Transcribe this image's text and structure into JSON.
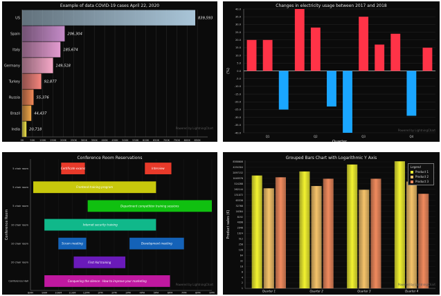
{
  "colors": {
    "panel_bg": "#0b0b0b",
    "text": "#e6e6e6",
    "grid": "#2e2e2e",
    "positive_bar": "#ff3347",
    "negative_bar": "#1aa6ff",
    "product_1": "#f2f230",
    "product_2": "#f5c36a",
    "product_3": "#f08a5d"
  },
  "watermark": "Powered by LightningChart",
  "chart_data": [
    {
      "type": "bar",
      "orientation": "horizontal",
      "title": "Example of data COVID-19 cases April 22, 2020",
      "categories": [
        "US",
        "Spain",
        "Italy",
        "Germany",
        "Turkey",
        "Russia",
        "Brazil",
        "India"
      ],
      "values": [
        839593,
        206304,
        185674,
        149518,
        92877,
        55376,
        44437,
        20718
      ],
      "value_labels": [
        "839,593",
        "206,304",
        "185,674",
        "149,518",
        "92,877",
        "55,376",
        "44,437",
        "20,718"
      ],
      "bar_colors": [
        "#a9c5d8",
        "#c58bc8",
        "#e39bd0",
        "#f5a8c8",
        "#f6857e",
        "#f08858",
        "#f4a94a",
        "#f2e44a"
      ],
      "xlim": [
        0,
        900000
      ],
      "x_ticks": [
        "0K",
        "50K",
        "100K",
        "150K",
        "200K",
        "250K",
        "300K",
        "350K",
        "400K",
        "450K",
        "500K",
        "550K",
        "600K",
        "650K",
        "700K",
        "750K",
        "800K",
        "850K"
      ]
    },
    {
      "type": "bar",
      "title": "Changes in electricity usage between 2017 and 2018",
      "xlabel": "Quarter",
      "ylabel": "(%)",
      "ylim": [
        -40,
        40
      ],
      "y_ticks": [
        "40.0",
        "35.0",
        "30.0",
        "25.0",
        "20.0",
        "15.0",
        "10.0",
        "5.0",
        "0.0",
        "-5.0",
        "-10.0",
        "-15.0",
        "-20.0",
        "-25.0",
        "-30.0",
        "-35.0",
        "-40.0"
      ],
      "quarter_labels": [
        "Q1",
        "Q2",
        "Q3",
        "Q4"
      ],
      "values": [
        20,
        20,
        -25,
        40,
        28,
        -23,
        -40,
        35,
        17,
        24,
        -29,
        15
      ]
    },
    {
      "type": "gantt",
      "title": "Conference Room Reservations",
      "ylabel": "Conference Room",
      "rows": [
        "5 chair room",
        "5 chair room",
        "5 chair room",
        "10 chair room",
        "10 chair room",
        "20 chair room",
        "Conference Hall"
      ],
      "x_ticks": [
        "8AM",
        "9AM",
        "10AM",
        "11AM",
        "12PM",
        "1PM",
        "2PM",
        "3PM",
        "4PM",
        "5PM",
        "6PM",
        "7PM",
        "8PM",
        "9PM"
      ],
      "x_range_hours": [
        8,
        21
      ],
      "events": [
        {
          "row": 0,
          "start": 10.2,
          "end": 11.9,
          "label": "Certificate exams",
          "color": "#e83a2a"
        },
        {
          "row": 0,
          "start": 16.2,
          "end": 18.1,
          "label": "Interview",
          "color": "#e83a2a"
        },
        {
          "row": 1,
          "start": 8.2,
          "end": 17.0,
          "label": "Frontend training program",
          "color": "#c8c80c"
        },
        {
          "row": 2,
          "start": 12.1,
          "end": 21.0,
          "label": "Department competition training sessions",
          "color": "#10c010"
        },
        {
          "row": 3,
          "start": 9.0,
          "end": 17.0,
          "label": "Internet security training",
          "color": "#10b88a"
        },
        {
          "row": 4,
          "start": 10.0,
          "end": 12.0,
          "label": "Scrum meeting",
          "color": "#1462b8"
        },
        {
          "row": 4,
          "start": 15.1,
          "end": 19.0,
          "label": "Development meeting",
          "color": "#1462b8"
        },
        {
          "row": 5,
          "start": 11.1,
          "end": 14.8,
          "label": "First Aid training",
          "color": "#6a1aba"
        },
        {
          "row": 6,
          "start": 9.0,
          "end": 18.0,
          "label": "Conquering the silence - How to improve your marketing",
          "color": "#c018a0"
        }
      ]
    },
    {
      "type": "bar",
      "title": "Grouped Bars Chart with Logarithmic Y Axis",
      "ylabel": "Product sales (€)",
      "yscale": "log",
      "ylim": [
        1,
        10000000
      ],
      "y_ticks": [
        "1",
        "2",
        "4",
        "8",
        "16",
        "32",
        "64",
        "128",
        "256",
        "512",
        "1024",
        "2048",
        "4096",
        "8192",
        "16384",
        "32768",
        "65536",
        "131072",
        "262144",
        "524288",
        "1048576",
        "2097152",
        "4194304",
        "8388608"
      ],
      "categories": [
        "Quarter 1",
        "Quarter 2",
        "Quarter 3",
        "Quarter 4"
      ],
      "series": [
        {
          "name": "Product 1",
          "values": [
            1500000,
            2500000,
            6000000,
            9000000
          ]
        },
        {
          "name": "Product 2",
          "values": [
            300000,
            400000,
            250000,
            700000
          ]
        },
        {
          "name": "Product 3",
          "values": [
            1200000,
            1000000,
            1000000,
            150000
          ]
        }
      ],
      "legend_title": "Legend",
      "legend_position": "top-right"
    }
  ]
}
